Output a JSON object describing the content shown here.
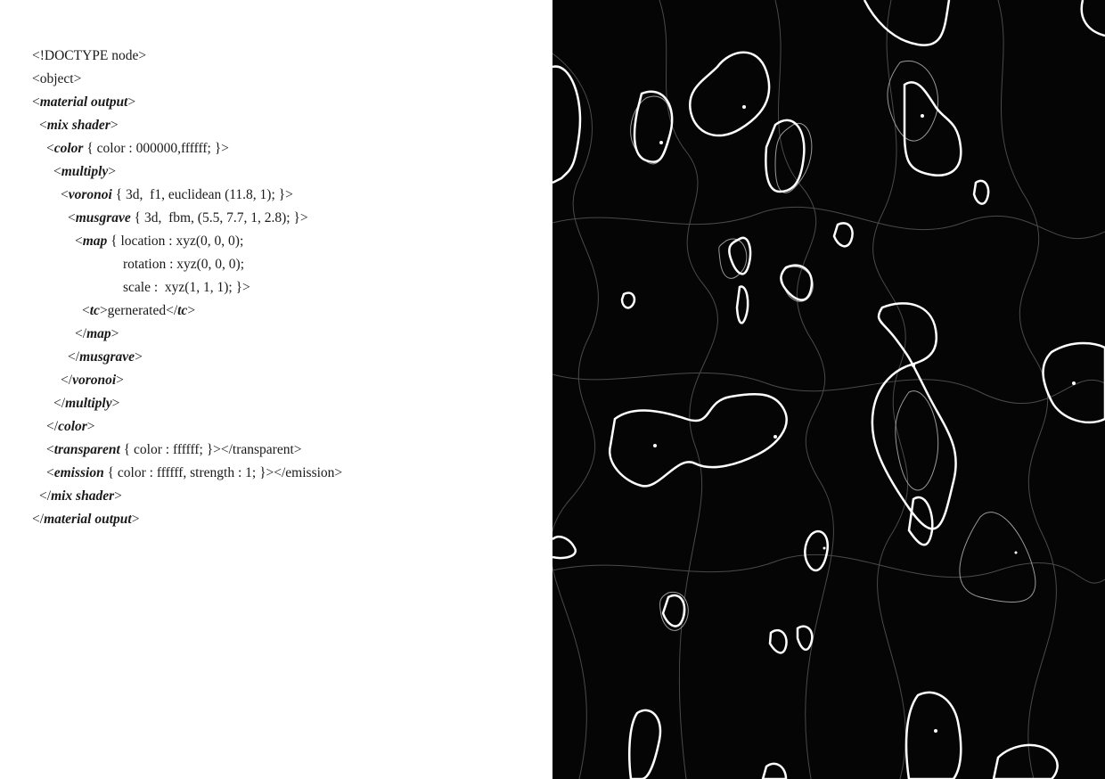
{
  "left_page": {
    "code_lines": [
      [
        {
          "t": "<!DOCTYPE node>",
          "i": false
        }
      ],
      [
        {
          "t": "<object>",
          "i": false
        }
      ],
      [
        {
          "t": "<",
          "i": false
        },
        {
          "t": "material output",
          "i": true
        },
        {
          "t": ">",
          "i": false
        }
      ],
      [
        {
          "t": "<",
          "i": false
        },
        {
          "t": "mix shader",
          "i": true
        },
        {
          "t": ">",
          "i": false
        }
      ],
      [
        {
          "t": "<",
          "i": false
        },
        {
          "t": "color",
          "i": true
        },
        {
          "t": " { color : 000000,ffffff; }>",
          "i": false
        }
      ],
      [
        {
          "t": "<",
          "i": false
        },
        {
          "t": "multiply",
          "i": true
        },
        {
          "t": ">",
          "i": false
        }
      ],
      [
        {
          "t": "<",
          "i": false
        },
        {
          "t": "voronoi",
          "i": true
        },
        {
          "t": " { 3d,  f1, euclidean (11.8, 1); }>",
          "i": false
        }
      ],
      [
        {
          "t": "<",
          "i": false
        },
        {
          "t": "musgrave",
          "i": true
        },
        {
          "t": " { 3d,  fbm, (5.5, 7.7, 1, 2.8); }>",
          "i": false
        }
      ],
      [
        {
          "t": "<",
          "i": false
        },
        {
          "t": "map",
          "i": true
        },
        {
          "t": " { location : xyz(0, 0, 0);",
          "i": false
        }
      ],
      [
        {
          "t": "rotation : xyz(0, 0, 0);",
          "i": false
        }
      ],
      [
        {
          "t": "scale :  xyz(1, 1, 1); }>",
          "i": false
        }
      ],
      [
        {
          "t": "<",
          "i": false
        },
        {
          "t": "tc",
          "i": true
        },
        {
          "t": ">gernerated</",
          "i": false
        },
        {
          "t": "tc",
          "i": true
        },
        {
          "t": ">",
          "i": false
        }
      ],
      [
        {
          "t": "</",
          "i": false
        },
        {
          "t": "map",
          "i": true
        },
        {
          "t": ">",
          "i": false
        }
      ],
      [
        {
          "t": "</",
          "i": false
        },
        {
          "t": "musgrave",
          "i": true
        },
        {
          "t": ">",
          "i": false
        }
      ],
      [
        {
          "t": "</",
          "i": false
        },
        {
          "t": "voronoi",
          "i": true
        },
        {
          "t": ">",
          "i": false
        }
      ],
      [
        {
          "t": "</",
          "i": false
        },
        {
          "t": "multiply",
          "i": true
        },
        {
          "t": ">",
          "i": false
        }
      ],
      [
        {
          "t": "</",
          "i": false
        },
        {
          "t": "color",
          "i": true
        },
        {
          "t": ">",
          "i": false
        }
      ],
      [
        {
          "t": "<",
          "i": false
        },
        {
          "t": "transparent",
          "i": true
        },
        {
          "t": " { color : ffffff; }></transparent>",
          "i": false
        }
      ],
      [
        {
          "t": "<",
          "i": false
        },
        {
          "t": "emission",
          "i": true
        },
        {
          "t": " { color : ffffff, strength : 1; }></emission>",
          "i": false
        }
      ],
      [
        {
          "t": "</",
          "i": false
        },
        {
          "t": "mix shader",
          "i": true
        },
        {
          "t": ">",
          "i": false
        }
      ],
      [
        {
          "t": "</",
          "i": false
        },
        {
          "t": "material output",
          "i": true
        },
        {
          "t": ">",
          "i": false
        }
      ]
    ]
  },
  "right_page": {
    "background_color": "#050505",
    "line_color": "#ffffff"
  }
}
